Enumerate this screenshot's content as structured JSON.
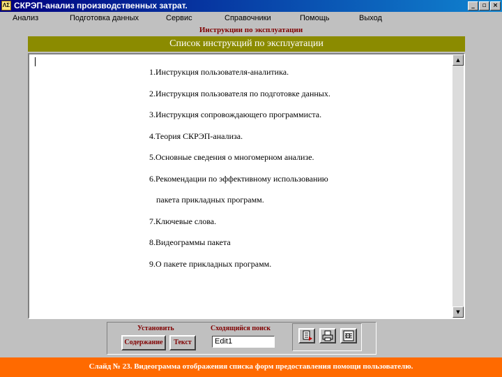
{
  "window": {
    "icon_text": "ΛΣ",
    "title": "СКРЭП-анализ производственных затрат.",
    "controls": [
      "_",
      "▫",
      "×"
    ]
  },
  "menu": [
    "Анализ",
    "Подготовка данных",
    "Сервис",
    "Справочники",
    "Помощь",
    "Выход"
  ],
  "form": {
    "title": "Инструкции по эксплуатации",
    "list_header": "Список инструкций по эксплуатации"
  },
  "document": {
    "lines": [
      "1.Инструкция пользователя-аналитика.",
      "2.Инструкция пользователя по подготовке данных.",
      "3.Инструкция сопровождающего программиста.",
      "4.Теория СКРЭП-анализа.",
      "5.Основные сведения о многомерном анализе.",
      "6.Рекомендации по эффективному использованию",
      "пакета прикладных программ.",
      "7.Ключевые слова.",
      "8.Видеограммы пакета",
      "9.О пакете прикладных программ."
    ]
  },
  "bottom": {
    "install_label": "Установить",
    "contents_button": "Содержание",
    "text_button": "Текст",
    "search_label": "Сходящийся поиск",
    "search_value": "Edit1"
  },
  "footer": {
    "caption": "Слайд № 23. Видеограмма отображения списка форм предоставления помощи пользователю."
  }
}
